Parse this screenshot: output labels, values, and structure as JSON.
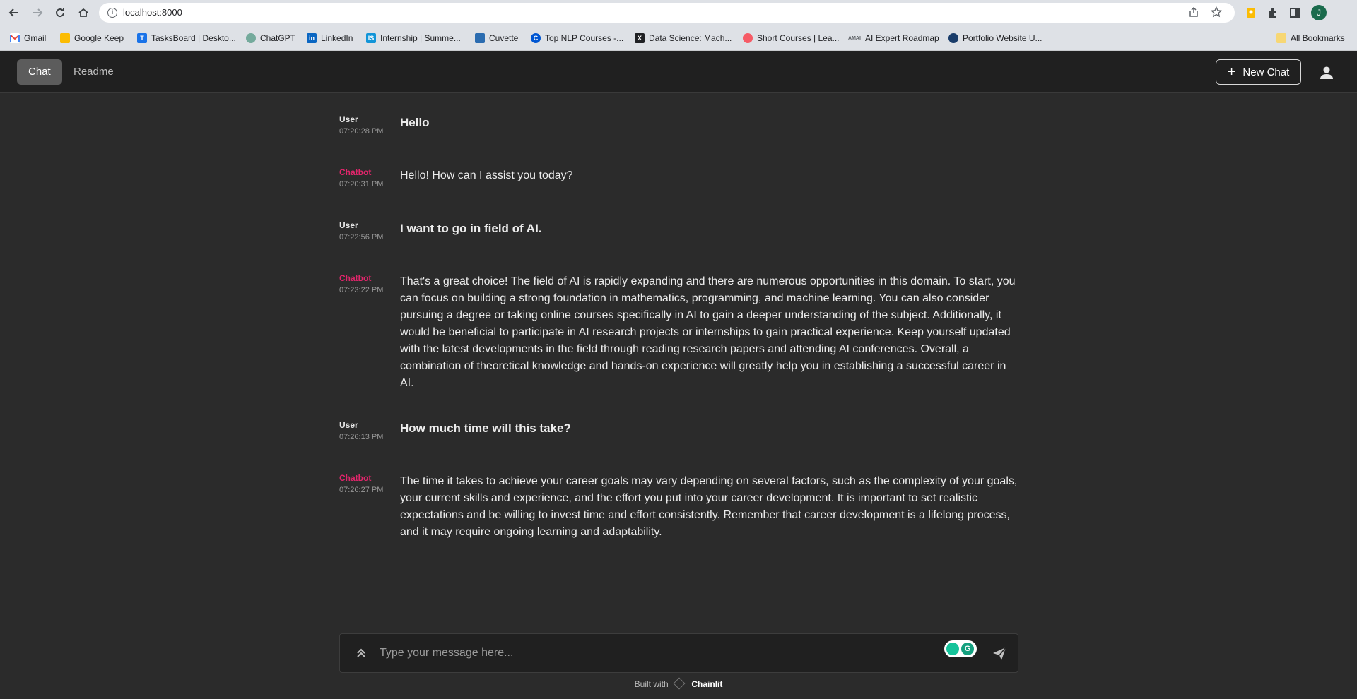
{
  "browser": {
    "url": "localhost:8000",
    "profile_initial": "J",
    "bookmarks": [
      {
        "label": "Gmail",
        "icon": "gmail-icon",
        "color": "#ea4335"
      },
      {
        "label": "Google Keep",
        "icon": "keep-icon",
        "color": "#fbbc04"
      },
      {
        "label": "TasksBoard | Deskto...",
        "icon": "tasksboard-icon",
        "color": "#1a73e8"
      },
      {
        "label": "ChatGPT",
        "icon": "chatgpt-icon",
        "color": "#74aa9c"
      },
      {
        "label": "LinkedIn",
        "icon": "linkedin-icon",
        "color": "#0a66c2"
      },
      {
        "label": "Internship | Summe...",
        "icon": "internshala-icon",
        "color": "#1295d8"
      },
      {
        "label": "Cuvette",
        "icon": "cuvette-icon",
        "color": "#2b6cb0"
      },
      {
        "label": "Top NLP Courses -...",
        "icon": "coursera-icon",
        "color": "#0056d2"
      },
      {
        "label": "Data Science: Mach...",
        "icon": "edx-icon",
        "color": "#202124"
      },
      {
        "label": "Short Courses | Lea...",
        "icon": "deeplearning-icon",
        "color": "#f65b66"
      },
      {
        "label": "AI Expert Roadmap",
        "icon": "ai-roadmap-icon",
        "color": "#5f6368"
      },
      {
        "label": "Portfolio Website U...",
        "icon": "portfolio-icon",
        "color": "#1a3d6b"
      }
    ],
    "all_bookmarks": "All Bookmarks"
  },
  "header": {
    "tabs": [
      {
        "label": "Chat",
        "active": true
      },
      {
        "label": "Readme",
        "active": false
      }
    ],
    "new_chat_label": "New Chat"
  },
  "messages": [
    {
      "author": "User",
      "time": "07:20:28 PM",
      "text": "Hello"
    },
    {
      "author": "Chatbot",
      "time": "07:20:31 PM",
      "text": "Hello! How can I assist you today?"
    },
    {
      "author": "User",
      "time": "07:22:56 PM",
      "text": "I want to go in field of AI."
    },
    {
      "author": "Chatbot",
      "time": "07:23:22 PM",
      "text": "That's a great choice! The field of AI is rapidly expanding and there are numerous opportunities in this domain. To start, you can focus on building a strong foundation in mathematics, programming, and machine learning. You can also consider pursuing a degree or taking online courses specifically in AI to gain a deeper understanding of the subject. Additionally, it would be beneficial to participate in AI research projects or internships to gain practical experience. Keep yourself updated with the latest developments in the field through reading research papers and attending AI conferences. Overall, a combination of theoretical knowledge and hands-on experience will greatly help you in establishing a successful career in AI."
    },
    {
      "author": "User",
      "time": "07:26:13 PM",
      "text": "How much time will this take?"
    },
    {
      "author": "Chatbot",
      "time": "07:26:27 PM",
      "text": "The time it takes to achieve your career goals may vary depending on several factors, such as the complexity of your goals, your current skills and experience, and the effort you put into your career development. It is important to set realistic expectations and be willing to invest time and effort consistently. Remember that career development is a lifelong process, and it may require ongoing learning and adaptability."
    }
  ],
  "composer": {
    "placeholder": "Type your message here..."
  },
  "footer": {
    "built_with": "Built with",
    "brand": "Chainlit"
  },
  "colors": {
    "bot_author": "#e2256b",
    "background": "#2b2b2b",
    "header": "#202020"
  }
}
